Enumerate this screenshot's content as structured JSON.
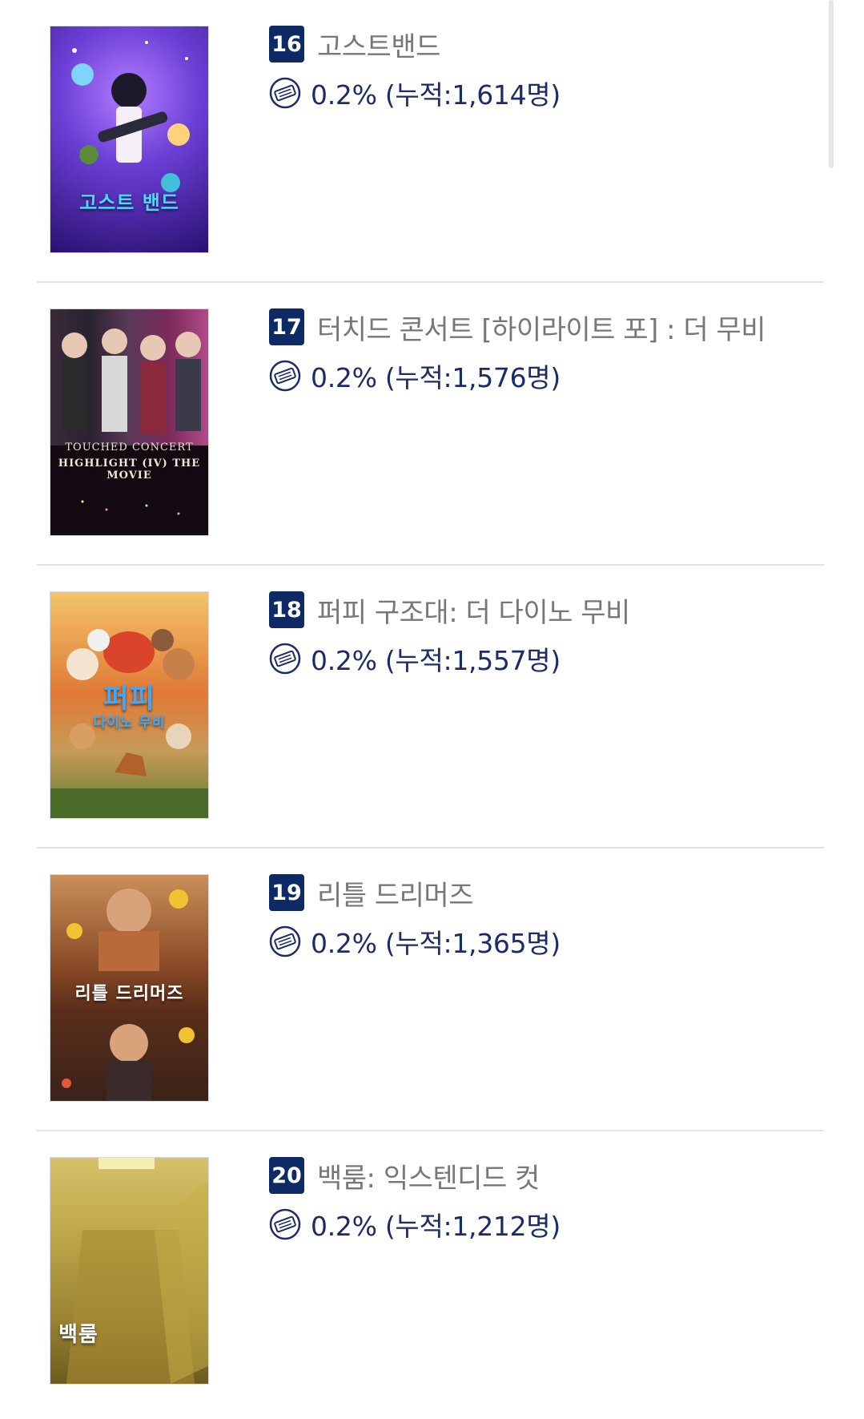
{
  "movies": [
    {
      "rank": "16",
      "title": "고스트밴드",
      "stat": "0.2% (누적:1,614명)",
      "poster_text": "고스트 밴드",
      "poster_colors": [
        "#3a1a8c",
        "#6b3fd6",
        "#b27cff"
      ],
      "poster_text_color": "#4fd8ff"
    },
    {
      "rank": "17",
      "title": "터치드 콘서트 [하이라이트 포] : 더 무비",
      "stat": "0.2% (누적:1,576명)",
      "poster_text": "HIGHLIGHT (IV) THE MOVIE",
      "poster_subtext": "TOUCHED CONCERT",
      "poster_colors": [
        "#140b12",
        "#4a2140",
        "#8d3a6a"
      ],
      "poster_text_color": "#f2e6d8"
    },
    {
      "rank": "18",
      "title": "퍼피 구조대: 더 다이노 무비",
      "stat": "0.2% (누적:1,557명)",
      "poster_text": "퍼피",
      "poster_subtext": "다이노 무비",
      "poster_colors": [
        "#f0b14a",
        "#d8652a",
        "#5e7a32"
      ],
      "poster_text_color": "#3fa8ff"
    },
    {
      "rank": "19",
      "title": "리틀 드리머즈",
      "stat": "0.2% (누적:1,365명)",
      "poster_text": "리틀 드리머즈",
      "poster_colors": [
        "#d99a4b",
        "#8a4a26",
        "#3a2218"
      ],
      "poster_text_color": "#ffffff"
    },
    {
      "rank": "20",
      "title": "백룸: 익스텐디드 컷",
      "stat": "0.2% (누적:1,212명)",
      "poster_text": "백룸",
      "poster_colors": [
        "#c7b14d",
        "#a38a2f",
        "#6d5a1e"
      ],
      "poster_text_color": "#ffffff"
    }
  ],
  "colors": {
    "rank_badge": "#0e2a64",
    "title": "#777777",
    "stat": "#1b2c66",
    "divider": "#e3e3e3"
  },
  "icons": {
    "stat_icon": "ticket-icon"
  }
}
